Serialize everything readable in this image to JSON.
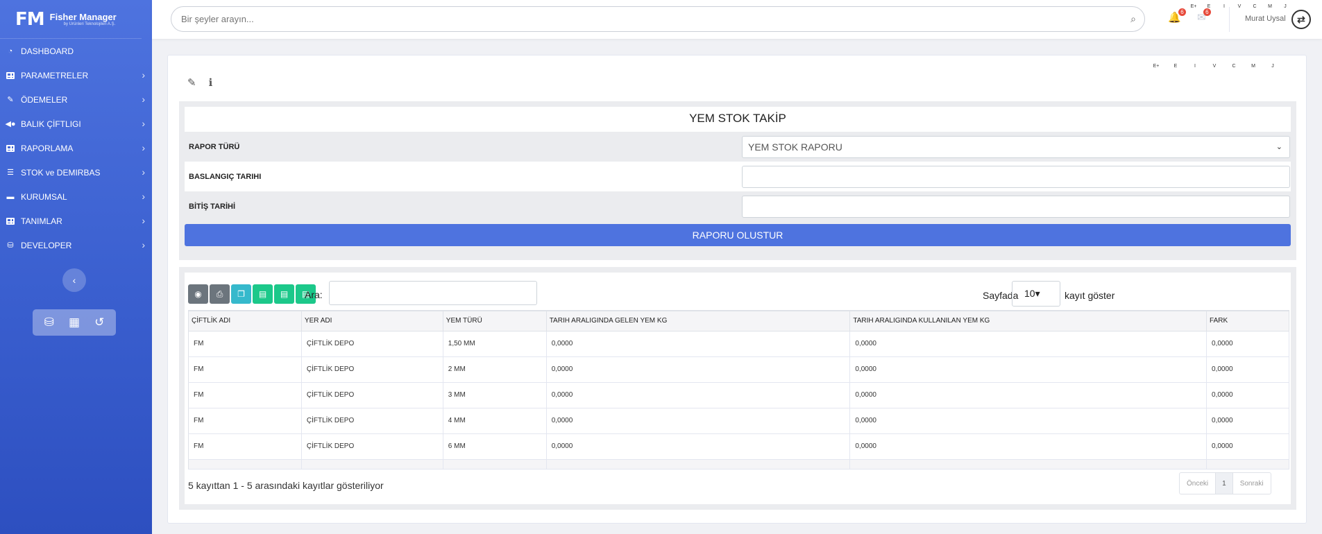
{
  "brand": {
    "logo": "FM",
    "name": "Fisher Manager",
    "tagline": "by Ürünleri Teknolojileri A.Ş."
  },
  "sidebar": {
    "items": [
      {
        "label": "DASHBOARD",
        "icon": "dashboard-icon"
      },
      {
        "label": "PARAMETRELER",
        "icon": "table-icon"
      },
      {
        "label": "ÖDEMELER",
        "icon": "payment-icon"
      },
      {
        "label": "BALIK ÇİFTLIGI",
        "icon": "fish-icon"
      },
      {
        "label": "RAPORLAMA",
        "icon": "table-icon"
      },
      {
        "label": "STOK ve DEMIRBAS",
        "icon": "list-icon"
      },
      {
        "label": "KURUMSAL",
        "icon": "folder-icon"
      },
      {
        "label": "TANIMLAR",
        "icon": "table-icon"
      },
      {
        "label": "DEVELOPER",
        "icon": "database-icon"
      }
    ]
  },
  "topbar": {
    "search_placeholder": "Bir şeyler arayın...",
    "notifications_count": "6",
    "messages_count": "6",
    "user_name": "Murat Uysal",
    "letters": [
      "E+",
      "E",
      "I",
      "V",
      "C",
      "M",
      "J"
    ]
  },
  "card": {
    "letters": [
      "E+",
      "E",
      "I",
      "V",
      "C",
      "M",
      "J"
    ]
  },
  "report": {
    "title": "YEM STOK TAKİP",
    "rapor_turu_label": "RAPOR TÜRÜ",
    "rapor_turu_value": "YEM STOK RAPORU",
    "baslangic_label": "BASLANGIÇ TARIHI",
    "baslangic_value": "",
    "bitis_label": "BİTİŞ TARİHİ",
    "bitis_value": "",
    "submit_label": "RAPORU OLUSTUR"
  },
  "table": {
    "search_label": "Ara:",
    "search_value": "",
    "page_size_prefix": "Sayfada",
    "page_size": "10",
    "page_size_suffix": "kayıt göster",
    "columns": [
      "ÇİFTLİK ADI",
      "YER ADI",
      "YEM TÜRÜ",
      "TARIH ARALIGINDA GELEN YEM KG",
      "TARIH ARALIGINDA KULLANILAN YEM KG",
      "FARK"
    ],
    "rows": [
      [
        "FM",
        "ÇİFTLİK DEPO",
        "1,50 MM",
        "0,0000",
        "0,0000",
        "0,0000"
      ],
      [
        "FM",
        "ÇİFTLİK DEPO",
        "2 MM",
        "0,0000",
        "0,0000",
        "0,0000"
      ],
      [
        "FM",
        "ÇİFTLİK DEPO",
        "3 MM",
        "0,0000",
        "0,0000",
        "0,0000"
      ],
      [
        "FM",
        "ÇİFTLİK DEPO",
        "4 MM",
        "0,0000",
        "0,0000",
        "0,0000"
      ],
      [
        "FM",
        "ÇİFTLİK DEPO",
        "6 MM",
        "0,0000",
        "0,0000",
        "0,0000"
      ]
    ],
    "info": "5 kayıttan 1 - 5 arasındaki kayıtlar gösteriliyor",
    "pager": {
      "prev": "Önceki",
      "current": "1",
      "next": "Sonraki"
    }
  }
}
